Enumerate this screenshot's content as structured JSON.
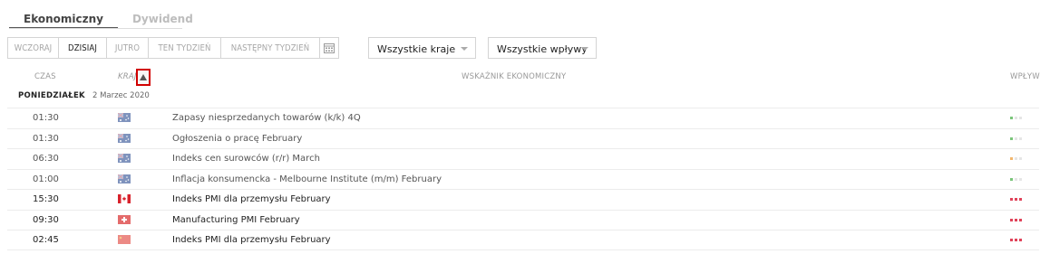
{
  "tabs": [
    {
      "label": "Ekonomiczny",
      "active": true
    },
    {
      "label": "Dywidend",
      "active": false
    }
  ],
  "day_buttons": [
    {
      "label": "WCZORAJ",
      "active": false
    },
    {
      "label": "DZISIAJ",
      "active": true
    },
    {
      "label": "JUTRO",
      "active": false
    },
    {
      "label": "TEN TYDZIEŃ",
      "active": false
    },
    {
      "label": "NASTĘPNY TYDZIEŃ",
      "active": false
    }
  ],
  "filters": {
    "country": "Wszystkie kraje",
    "impact": "Wszystkie wpływy"
  },
  "columns": {
    "time": "CZAS",
    "country": "KRAJ",
    "indicator": "WSKAŹNIK EKONOMICZNY",
    "impact": "WPŁYW"
  },
  "date_group": {
    "day": "PONIEDZIAŁEK",
    "date": "2 Marzec 2020"
  },
  "colors": {
    "impact_low": "#7bc67b",
    "impact_medium": "#f2b66d",
    "impact_high": "#e0435a",
    "sort_highlight": "#d10000"
  },
  "events": [
    {
      "time": "01:30",
      "flag": "australia-flag",
      "indicator": "Zapasy niesprzedanych towarów (k/k) 4Q",
      "impact": "low"
    },
    {
      "time": "01:30",
      "flag": "australia-flag",
      "indicator": "Ogłoszenia o pracę February",
      "impact": "low"
    },
    {
      "time": "06:30",
      "flag": "australia-flag",
      "indicator": "Indeks cen surowców (r/r) March",
      "impact": "medium"
    },
    {
      "time": "01:00",
      "flag": "australia-flag",
      "indicator": "Inflacja konsumencka - Melbourne Institute (m/m) February",
      "impact": "low"
    },
    {
      "time": "15:30",
      "flag": "canada-flag",
      "indicator": "Indeks PMI dla przemysłu February",
      "impact": "high"
    },
    {
      "time": "09:30",
      "flag": "switzerland-flag",
      "indicator": "Manufacturing PMI February",
      "impact": "high"
    },
    {
      "time": "02:45",
      "flag": "china-flag",
      "indicator": "Indeks PMI dla przemysłu February",
      "impact": "high"
    }
  ]
}
